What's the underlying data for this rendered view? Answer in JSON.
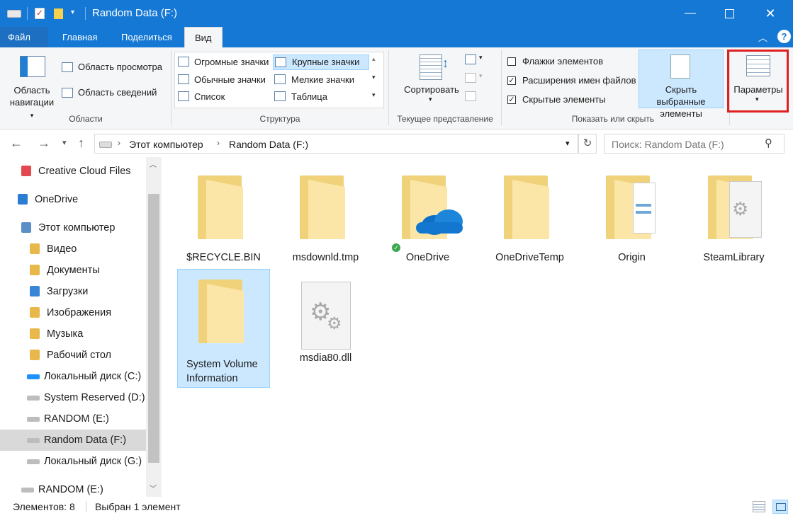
{
  "window": {
    "title": "Random Data (F:)"
  },
  "ribbon_tabs": [
    "Файл",
    "Главная",
    "Поделиться",
    "Вид"
  ],
  "panes": {
    "nav_pane": "Область навигации",
    "preview_pane": "Область просмотра",
    "details_pane": "Область сведений",
    "group_label": "Области"
  },
  "layout": {
    "options": [
      [
        "Огромные значки",
        "Крупные значки"
      ],
      [
        "Обычные значки",
        "Мелкие значки"
      ],
      [
        "Список",
        "Таблица"
      ]
    ],
    "selected": "Крупные значки",
    "group_label": "Структура"
  },
  "current_view": {
    "sort_label": "Сортировать",
    "group_label": "Текущее представление"
  },
  "show_hide": {
    "checkboxes": [
      {
        "label": "Флажки элементов",
        "checked": false
      },
      {
        "label": "Расширения имен файлов",
        "checked": true
      },
      {
        "label": "Скрытые элементы",
        "checked": true
      }
    ],
    "hide_selected": "Скрыть выбранные элементы",
    "group_label": "Показать или скрыть"
  },
  "options_button": "Параметры",
  "address": {
    "segments": [
      "Этот компьютер",
      "Random Data (F:)"
    ],
    "search_placeholder": "Поиск: Random Data (F:)"
  },
  "sidebar": {
    "items": [
      {
        "label": "Creative Cloud Files",
        "icon": "creative-cloud-icon"
      },
      {
        "label": "OneDrive",
        "icon": "onedrive-icon"
      },
      {
        "label": "Этот компьютер",
        "icon": "computer-icon"
      },
      {
        "label": "Видео",
        "icon": "video-folder-icon"
      },
      {
        "label": "Документы",
        "icon": "documents-folder-icon"
      },
      {
        "label": "Загрузки",
        "icon": "downloads-folder-icon"
      },
      {
        "label": "Изображения",
        "icon": "pictures-folder-icon"
      },
      {
        "label": "Музыка",
        "icon": "music-folder-icon"
      },
      {
        "label": "Рабочий стол",
        "icon": "desktop-folder-icon"
      },
      {
        "label": "Локальный диск (C:)",
        "icon": "windows-drive-icon"
      },
      {
        "label": "System Reserved (D:)",
        "icon": "drive-icon"
      },
      {
        "label": "RANDOM (E:)",
        "icon": "drive-icon"
      },
      {
        "label": "Random Data (F:)",
        "icon": "drive-icon"
      },
      {
        "label": "Локальный диск (G:)",
        "icon": "drive-icon"
      },
      {
        "label": "RANDOM (E:)",
        "icon": "drive-icon"
      }
    ],
    "selected": "Random Data (F:)"
  },
  "files": [
    {
      "name": "$RECYCLE.BIN",
      "type": "folder"
    },
    {
      "name": "msdownld.tmp",
      "type": "folder"
    },
    {
      "name": "OneDrive",
      "type": "onedrive-folder"
    },
    {
      "name": "OneDriveTemp",
      "type": "folder"
    },
    {
      "name": "Origin",
      "type": "folder-docs"
    },
    {
      "name": "SteamLibrary",
      "type": "folder-gear"
    },
    {
      "name": "System Volume Information",
      "type": "folder",
      "selected": true
    },
    {
      "name": "msdia80.dll",
      "type": "dll"
    }
  ],
  "status": {
    "count": "Элементов: 8",
    "selection": "Выбран 1 элемент"
  },
  "colors": {
    "accent": "#1478d4",
    "selection": "#cce8ff",
    "highlight_box": "#e02020"
  }
}
